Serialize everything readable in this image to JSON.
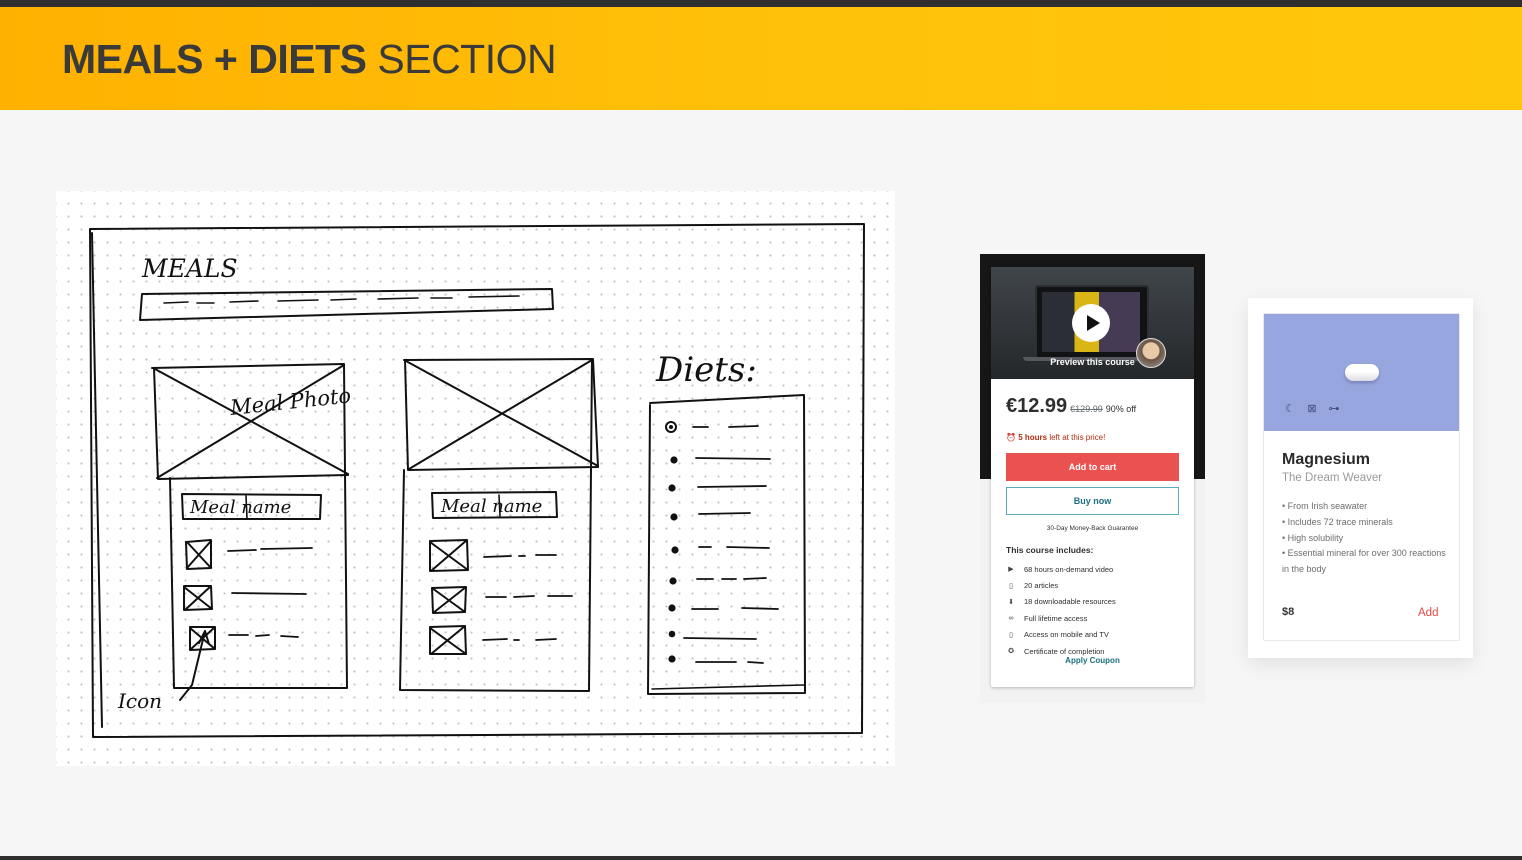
{
  "header": {
    "title_bold": "MEALS + DIETS",
    "title_light": "SECTION",
    "background_color": "#ffc107"
  },
  "wireframe": {
    "meals_title": "MEALS",
    "meal_photo_label": "Meal Photo",
    "meal_name_label": "Meal name",
    "diets_title": "Diets:",
    "icon_label": "Icon"
  },
  "course_card": {
    "preview_label": "Preview this course",
    "price": "€12.99",
    "original_price": "€129.99",
    "discount": "90% off",
    "timer_highlight": "5 hours",
    "timer_rest": " left at this price!",
    "add_to_cart": "Add to cart",
    "buy_now": "Buy now",
    "guarantee": "30-Day Money-Back Guarantee",
    "includes_title": "This course includes:",
    "includes": [
      {
        "icon": "video-icon",
        "glyph": "▶",
        "text": "68 hours on-demand video"
      },
      {
        "icon": "article-icon",
        "glyph": "▯",
        "text": "20 articles"
      },
      {
        "icon": "download-icon",
        "glyph": "⬇",
        "text": "18 downloadable resources"
      },
      {
        "icon": "infinity-icon",
        "glyph": "∞",
        "text": "Full lifetime access"
      },
      {
        "icon": "mobile-icon",
        "glyph": "▯",
        "text": "Access on mobile and TV"
      },
      {
        "icon": "certificate-icon",
        "glyph": "✪",
        "text": "Certificate of completion"
      }
    ],
    "apply_coupon": "Apply Coupon",
    "accent_color": "#ea5252"
  },
  "product_card": {
    "name": "Magnesium",
    "subtitle": "The Dream Weaver",
    "icons": [
      "moon-icon",
      "bandage-icon",
      "dumbbell-icon"
    ],
    "features": [
      "• From Irish seawater",
      "• Includes 72 trace minerals",
      "• High solubility",
      "• Essential mineral for over 300 reactions in the body"
    ],
    "price": "$8",
    "add_label": "Add",
    "image_color": "#98a6df"
  }
}
